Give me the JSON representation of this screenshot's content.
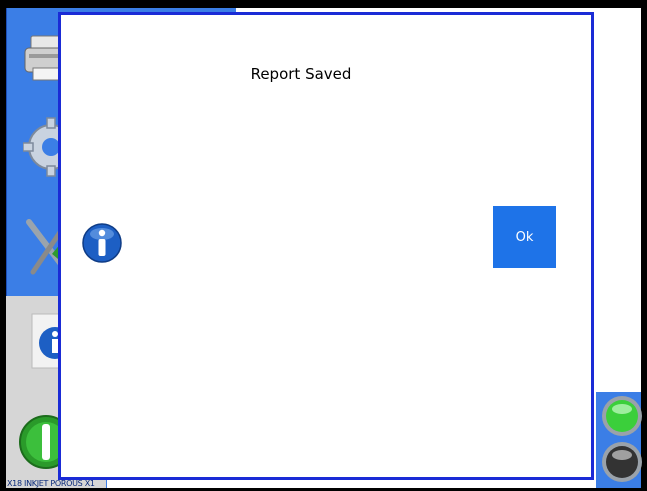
{
  "dialog": {
    "message": "Report Saved",
    "ok_label": "Ok"
  },
  "status_bar": {
    "text": "X18 INKJET POROUS X1"
  },
  "sidebar": {
    "items": [
      {
        "icon": "printer-icon"
      },
      {
        "icon": "gear-icon"
      },
      {
        "icon": "tools-icon"
      },
      {
        "icon": "info-icon"
      },
      {
        "icon": "power-icon"
      }
    ]
  },
  "indicators": [
    {
      "icon": "green-status-light-icon",
      "color": "#3bcf3b"
    },
    {
      "icon": "grey-status-light-icon",
      "color": "#333333"
    }
  ],
  "colors": {
    "accent": "#1e73e8",
    "dialog_border": "#1a2bd6",
    "sidebar": "#3b7ee6"
  }
}
